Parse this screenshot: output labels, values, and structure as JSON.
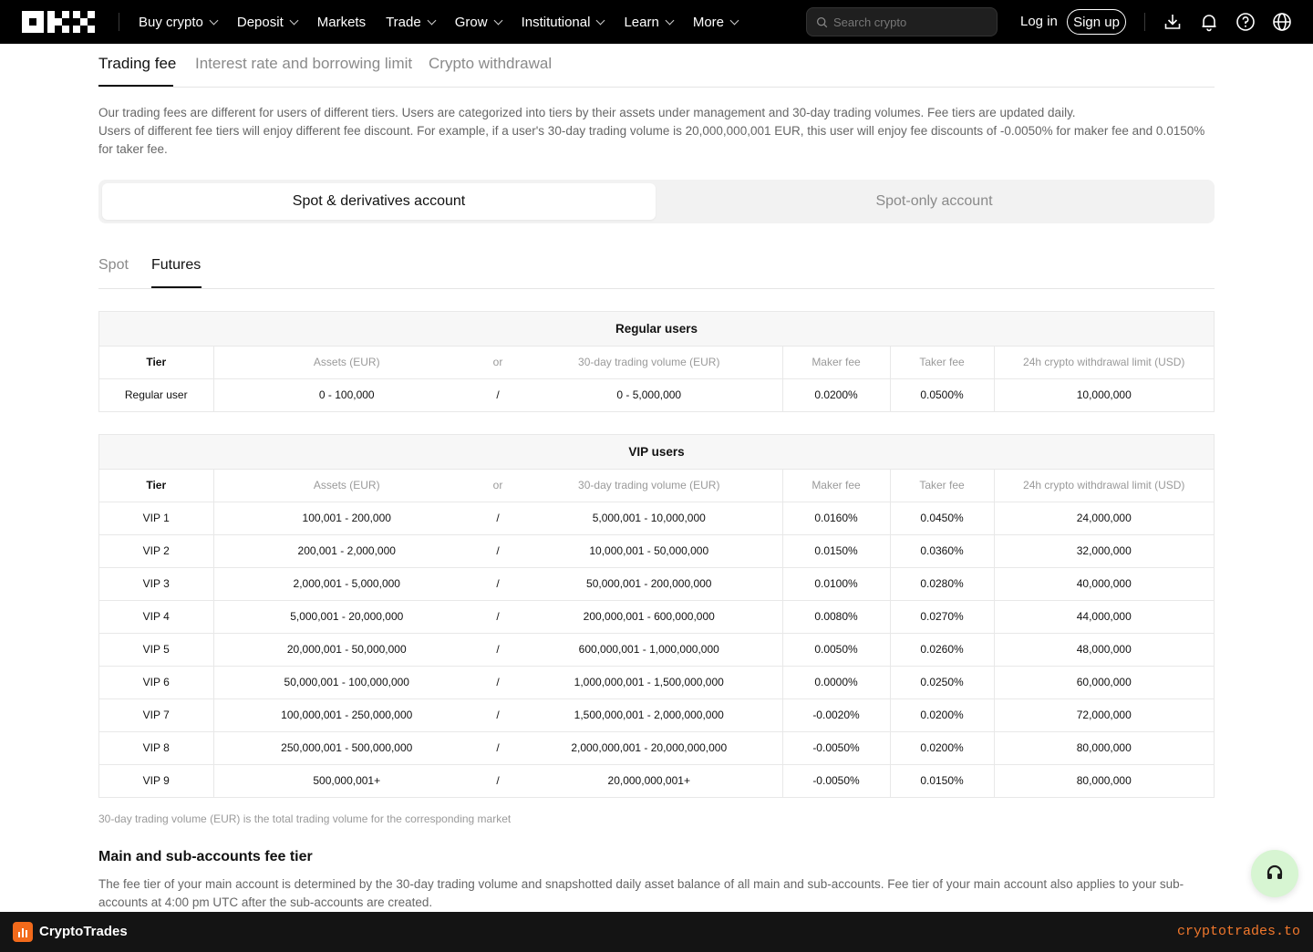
{
  "nav": {
    "items": [
      {
        "label": "Buy crypto",
        "dropdown": true
      },
      {
        "label": "Deposit",
        "dropdown": true
      },
      {
        "label": "Markets",
        "dropdown": false
      },
      {
        "label": "Trade",
        "dropdown": true
      },
      {
        "label": "Grow",
        "dropdown": true
      },
      {
        "label": "Institutional",
        "dropdown": true
      },
      {
        "label": "Learn",
        "dropdown": true
      },
      {
        "label": "More",
        "dropdown": true
      }
    ],
    "search_placeholder": "Search crypto",
    "login": "Log in",
    "signup": "Sign up"
  },
  "tabs": [
    "Trading fee",
    "Interest rate and borrowing limit",
    "Crypto withdrawal"
  ],
  "description": [
    "Our trading fees are different for users of different tiers. Users are categorized into tiers by their assets under management and 30-day trading volumes. Fee tiers are updated daily.",
    "Users of different fee tiers will enjoy different fee discount. For example, if a user's 30-day trading volume is 20,000,000,001 EUR, this user will enjoy fee discounts of -0.0050% for maker fee and 0.0150% for taker fee."
  ],
  "account_toggle": [
    "Spot & derivatives account",
    "Spot-only account"
  ],
  "subtabs": [
    "Spot",
    "Futures"
  ],
  "columns": {
    "tier": "Tier",
    "assets": "Assets (EUR)",
    "or": "or",
    "volume": "30-day trading volume (EUR)",
    "maker": "Maker fee",
    "taker": "Taker fee",
    "limit": "24h crypto withdrawal limit (USD)"
  },
  "regular": {
    "caption": "Regular users",
    "rows": [
      {
        "tier": "Regular user",
        "assets": "0 - 100,000",
        "or": "/",
        "volume": "0 - 5,000,000",
        "maker": "0.0200%",
        "taker": "0.0500%",
        "limit": "10,000,000"
      }
    ]
  },
  "vip": {
    "caption": "VIP users",
    "rows": [
      {
        "tier": "VIP 1",
        "assets": "100,001 - 200,000",
        "or": "/",
        "volume": "5,000,001 - 10,000,000",
        "maker": "0.0160%",
        "taker": "0.0450%",
        "limit": "24,000,000"
      },
      {
        "tier": "VIP 2",
        "assets": "200,001 - 2,000,000",
        "or": "/",
        "volume": "10,000,001 - 50,000,000",
        "maker": "0.0150%",
        "taker": "0.0360%",
        "limit": "32,000,000"
      },
      {
        "tier": "VIP 3",
        "assets": "2,000,001 - 5,000,000",
        "or": "/",
        "volume": "50,000,001 - 200,000,000",
        "maker": "0.0100%",
        "taker": "0.0280%",
        "limit": "40,000,000"
      },
      {
        "tier": "VIP 4",
        "assets": "5,000,001 - 20,000,000",
        "or": "/",
        "volume": "200,000,001 - 600,000,000",
        "maker": "0.0080%",
        "taker": "0.0270%",
        "limit": "44,000,000"
      },
      {
        "tier": "VIP 5",
        "assets": "20,000,001 - 50,000,000",
        "or": "/",
        "volume": "600,000,001 - 1,000,000,000",
        "maker": "0.0050%",
        "taker": "0.0260%",
        "limit": "48,000,000"
      },
      {
        "tier": "VIP 6",
        "assets": "50,000,001 - 100,000,000",
        "or": "/",
        "volume": "1,000,000,001 - 1,500,000,000",
        "maker": "0.0000%",
        "taker": "0.0250%",
        "limit": "60,000,000"
      },
      {
        "tier": "VIP 7",
        "assets": "100,000,001 - 250,000,000",
        "or": "/",
        "volume": "1,500,000,001 - 2,000,000,000",
        "maker": "-0.0020%",
        "taker": "0.0200%",
        "limit": "72,000,000"
      },
      {
        "tier": "VIP 8",
        "assets": "250,000,001 - 500,000,000",
        "or": "/",
        "volume": "2,000,000,001 - 20,000,000,000",
        "maker": "-0.0050%",
        "taker": "0.0200%",
        "limit": "80,000,000"
      },
      {
        "tier": "VIP 9",
        "assets": "500,000,001+",
        "or": "/",
        "volume": "20,000,000,001+",
        "maker": "-0.0050%",
        "taker": "0.0150%",
        "limit": "80,000,000"
      }
    ]
  },
  "note": "30-day trading volume (EUR) is the total trading volume for the corresponding market",
  "section2": {
    "title": "Main and sub-accounts fee tier",
    "text": "The fee tier of your main account is determined by the 30-day trading volume and snapshotted daily asset balance of all main and sub-accounts. Fee tier of your main account also applies to your sub-accounts at 4:00 pm UTC after the sub-accounts are created."
  },
  "footer": {
    "brand": "CryptoTrades",
    "url": "cryptotrades.to"
  },
  "colors": {
    "accent": "#121212",
    "footer_url": "#f2782c",
    "support_bg": "#d7f5d2"
  }
}
